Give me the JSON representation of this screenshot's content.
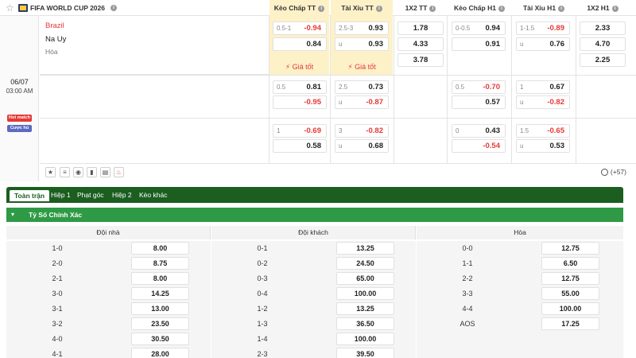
{
  "league": {
    "name": "FIFA WORLD CUP 2026"
  },
  "headers": [
    "Kèo Chấp TT",
    "Tài Xỉu TT",
    "1X2 TT",
    "Kèo Chấp H1",
    "Tài Xỉu H1",
    "1X2 H1"
  ],
  "match": {
    "date": "06/07",
    "time": "03:00 AM",
    "badge_hot": "Hot match",
    "badge_bet": "Cược hủ",
    "home": "Brazil",
    "away": "Na Uy",
    "draw": "Hòa"
  },
  "odds_rows": [
    {
      "hdp_tt": [
        {
          "line": "0.5-1",
          "val": "-0.94"
        },
        {
          "line": "",
          "val": "0.84"
        }
      ],
      "ou_tt": [
        {
          "line": "2.5-3",
          "val": "0.93"
        },
        {
          "line": "u",
          "val": "0.93"
        }
      ],
      "x12_tt": [
        "1.78",
        "4.33",
        "3.78"
      ],
      "hdp_h1": [
        {
          "line": "0-0.5",
          "val": "0.94"
        },
        {
          "line": "",
          "val": "0.91"
        }
      ],
      "ou_h1": [
        {
          "line": "1-1.5",
          "val": "-0.89"
        },
        {
          "line": "u",
          "val": "0.76"
        }
      ],
      "x12_h1": [
        "2.33",
        "4.70",
        "2.25"
      ]
    },
    {
      "hdp_tt": [
        {
          "line": "0.5",
          "val": "0.81"
        },
        {
          "line": "",
          "val": "-0.95"
        }
      ],
      "ou_tt": [
        {
          "line": "2.5",
          "val": "0.73"
        },
        {
          "line": "u",
          "val": "-0.87"
        }
      ],
      "hdp_h1": [
        {
          "line": "0.5",
          "val": "-0.70"
        },
        {
          "line": "",
          "val": "0.57"
        }
      ],
      "ou_h1": [
        {
          "line": "1",
          "val": "0.67"
        },
        {
          "line": "u",
          "val": "-0.82"
        }
      ]
    },
    {
      "hdp_tt": [
        {
          "line": "1",
          "val": "-0.69"
        },
        {
          "line": "",
          "val": "0.58"
        }
      ],
      "ou_tt": [
        {
          "line": "3",
          "val": "-0.82"
        },
        {
          "line": "u",
          "val": "0.68"
        }
      ],
      "hdp_h1": [
        {
          "line": "0",
          "val": "0.43"
        },
        {
          "line": "",
          "val": "-0.54"
        }
      ],
      "ou_h1": [
        {
          "line": "1.5",
          "val": "-0.65"
        },
        {
          "line": "u",
          "val": "0.53"
        }
      ]
    }
  ],
  "tips": [
    "Giá tốt",
    "Giá tốt"
  ],
  "more_markets": "(+57)",
  "tabs": [
    "Toàn trận",
    "Hiệp 1",
    "Phạt góc",
    "Hiệp 2",
    "Kèo khác"
  ],
  "market_title": "Tỷ Số Chính Xác",
  "correct_score": {
    "columns": [
      "Đội nhà",
      "Đội khách",
      "Hòa"
    ],
    "home": [
      [
        "1-0",
        "8.00"
      ],
      [
        "2-0",
        "8.75"
      ],
      [
        "2-1",
        "8.00"
      ],
      [
        "3-0",
        "14.25"
      ],
      [
        "3-1",
        "13.00"
      ],
      [
        "3-2",
        "23.50"
      ],
      [
        "4-0",
        "30.50"
      ],
      [
        "4-1",
        "28.00"
      ]
    ],
    "away": [
      [
        "0-1",
        "13.25"
      ],
      [
        "0-2",
        "24.50"
      ],
      [
        "0-3",
        "65.00"
      ],
      [
        "0-4",
        "100.00"
      ],
      [
        "1-2",
        "13.25"
      ],
      [
        "1-3",
        "36.50"
      ],
      [
        "1-4",
        "100.00"
      ],
      [
        "2-3",
        "39.50"
      ]
    ],
    "draw": [
      [
        "0-0",
        "12.75"
      ],
      [
        "1-1",
        "6.50"
      ],
      [
        "2-2",
        "12.75"
      ],
      [
        "3-3",
        "55.00"
      ],
      [
        "4-4",
        "100.00"
      ],
      [
        "AOS",
        "17.25"
      ]
    ]
  },
  "colors": {
    "accent_red": "#e53935",
    "highlight": "#fdf1c8",
    "tab_green": "#1b5e20",
    "market_green": "#2e9a45"
  }
}
